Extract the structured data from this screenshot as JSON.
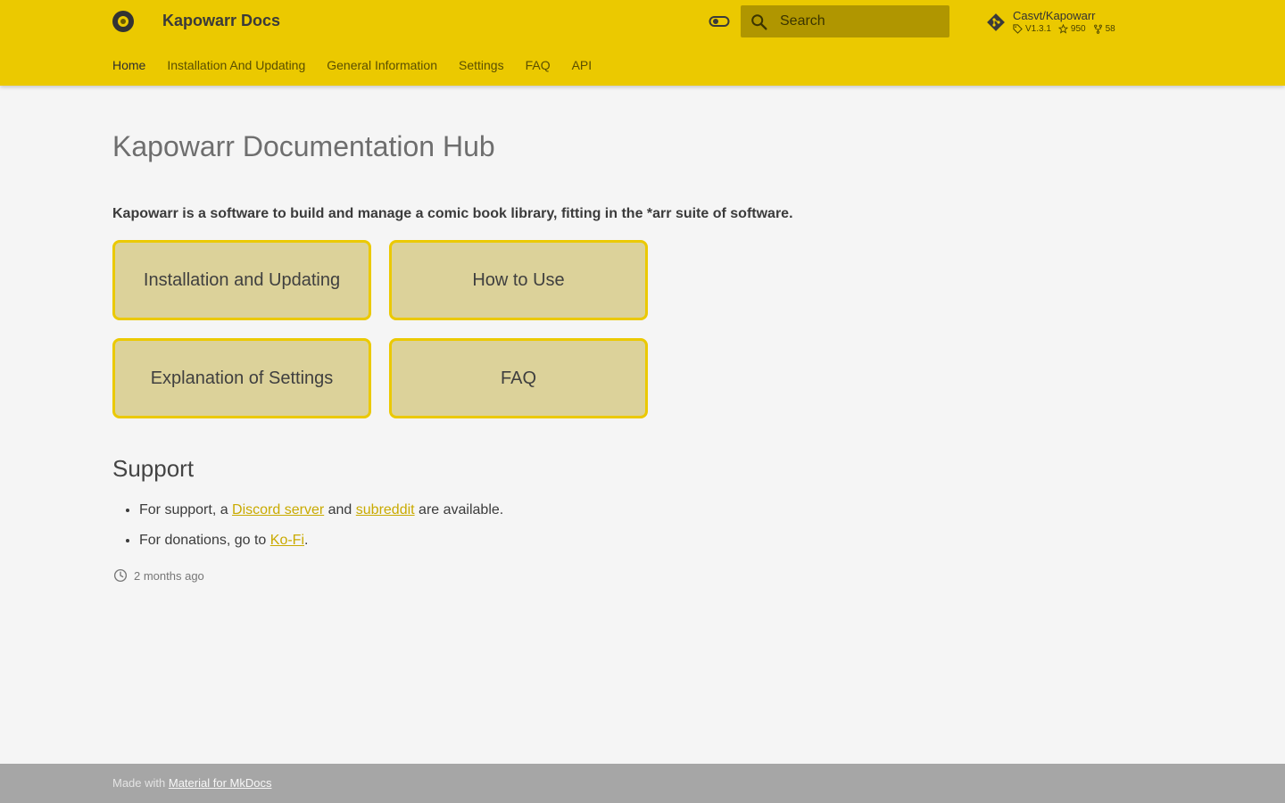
{
  "header": {
    "site_title": "Kapowarr Docs",
    "search_placeholder": "Search",
    "repo": {
      "name": "Casvt/Kapowarr",
      "version": "V1.3.1",
      "stars": "950",
      "forks": "58"
    }
  },
  "tabs": [
    {
      "label": "Home",
      "active": true
    },
    {
      "label": "Installation And Updating"
    },
    {
      "label": "General Information"
    },
    {
      "label": "Settings"
    },
    {
      "label": "FAQ"
    },
    {
      "label": "API"
    }
  ],
  "main": {
    "title": "Kapowarr Documentation Hub",
    "lead": "Kapowarr is a software to build and manage a comic book library, fitting in the *arr suite of software.",
    "cards": [
      {
        "label": "Installation and Updating"
      },
      {
        "label": "How to Use"
      },
      {
        "label": "Explanation of Settings"
      },
      {
        "label": "FAQ"
      }
    ],
    "support": {
      "heading": "Support",
      "item1": {
        "prefix": "For support, a ",
        "link1": "Discord server",
        "mid": " and ",
        "link2": "subreddit",
        "suffix": " are available."
      },
      "item2": {
        "prefix": "For donations, go to ",
        "link": "Ko-Fi",
        "suffix": "."
      }
    },
    "updated": "2 months ago"
  },
  "footer": {
    "prefix": "Made with ",
    "link": "Material for MkDocs"
  },
  "colors": {
    "primary": "#ebc900",
    "card_bg": "#dcd29a",
    "link": "#c9aa00"
  },
  "icons": [
    "logo-icon",
    "theme-toggle-icon",
    "search-icon",
    "git-icon",
    "tag-icon",
    "star-icon",
    "fork-icon",
    "clock-icon"
  ]
}
